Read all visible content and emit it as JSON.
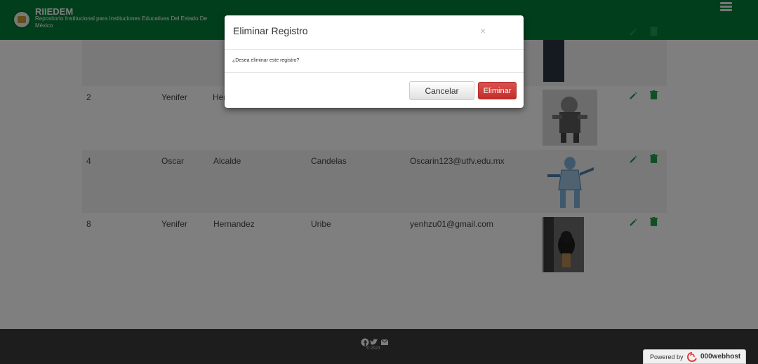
{
  "header": {
    "brand_title": "RIIEDEM",
    "brand_subtitle": "Repositorio Institucional para Instituciones Educativas Del Estado De México"
  },
  "table": {
    "rows": [
      {
        "id": "2",
        "name": "Yenifer",
        "last1": "Hernandez",
        "last2": "",
        "email": ""
      },
      {
        "id": "4",
        "name": "Oscar",
        "last1": "Alcalde",
        "last2": "Candelas",
        "email": "Oscarin123@utfv.edu.mx"
      },
      {
        "id": "8",
        "name": "Yenifer",
        "last1": "Hernandez",
        "last2": "Uribe",
        "email": "yenhzu01@gmail.com"
      }
    ],
    "partial_row_first_letters": "He"
  },
  "modal": {
    "title": "Eliminar Registro",
    "close": "×",
    "body": "¿Desea eliminar este registro?",
    "cancel_label": "Cancelar",
    "delete_label": "Eliminar"
  },
  "footer": {
    "copyright": "© 2023",
    "social_icons": [
      "facebook-icon",
      "twitter-icon",
      "email-icon"
    ]
  },
  "powered": {
    "prefix": "Powered by",
    "brand": "000webhost"
  },
  "colors": {
    "header_green": "#037f38",
    "action_green": "#1e9e4a",
    "delete_red": "#d9534f",
    "footer_dark": "#3a3a3a"
  }
}
